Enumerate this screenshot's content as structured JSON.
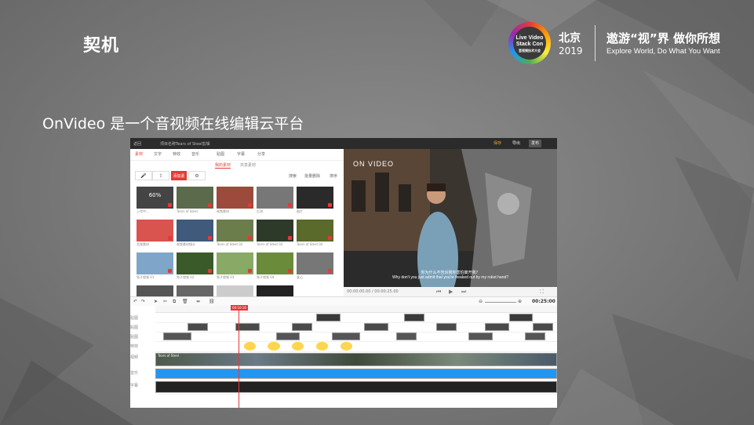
{
  "slide": {
    "title": "契机",
    "subtitle": "OnVideo 是一个音视频在线编辑云平台"
  },
  "brand": {
    "logo_lines": [
      "Live Video",
      "Stack Con",
      "音视频技术大会"
    ],
    "city": "北京",
    "year": "2019",
    "slogan": "遨游“视”界  做你所想",
    "slogan_en": "Explore World, Do What You Want"
  },
  "editor": {
    "topbar": {
      "back": "返回",
      "project_label": "项目名称",
      "project_name": "Tears of Steel剪辑",
      "save": "保存",
      "export": "导出",
      "publish": "发布"
    },
    "tabs": [
      "素材",
      "文字",
      "特效",
      "音乐",
      "贴图",
      "字幕",
      "分享"
    ],
    "active_tab": "素材",
    "subtabs": [
      "我的素材",
      "共享素材"
    ],
    "tools": {
      "mic": "🎤",
      "upload": "⇪",
      "add": "添加素材",
      "settings": "⚙",
      "search": "搜索",
      "batch": "批量删除",
      "sort": "排序"
    },
    "media": [
      {
        "caption": "上传中...",
        "label": "60%",
        "color": "#444"
      },
      {
        "caption": "Tears of Steel",
        "label": "",
        "color": "#5b6a4a"
      },
      {
        "caption": "视频素材",
        "label": "",
        "color": "#9c4a3b"
      },
      {
        "caption": "灯泡",
        "label": "",
        "color": "#777"
      },
      {
        "caption": "图片",
        "label": "",
        "color": "#2a2a2a"
      },
      {
        "caption": "音频素材",
        "label": "",
        "color": "#d9534f"
      },
      {
        "caption": "视频素材镜头",
        "label": "",
        "color": "#3f5a7a"
      },
      {
        "caption": "Tears of Steel 02",
        "label": "",
        "color": "#6b7d4a"
      },
      {
        "caption": "Tears of Steel 03",
        "label": "",
        "color": "#2d3a2a"
      },
      {
        "caption": "Tears of Steel 04",
        "label": "",
        "color": "#5a6a2a"
      },
      {
        "caption": "兔子视频 01",
        "label": "",
        "color": "#7fa6c9"
      },
      {
        "caption": "兔子视频 02",
        "label": "",
        "color": "#3a5a2a"
      },
      {
        "caption": "兔子视频 03",
        "label": "",
        "color": "#88aa66"
      },
      {
        "caption": "兔子视频 04",
        "label": "",
        "color": "#6a8c3a"
      },
      {
        "caption": "爱心",
        "label": "",
        "color": "#777"
      },
      {
        "caption": "",
        "label": "",
        "color": "#555"
      },
      {
        "caption": "",
        "label": "",
        "color": "#666"
      },
      {
        "caption": "",
        "label": "",
        "color": "#ccc"
      },
      {
        "caption": "",
        "label": "",
        "color": "#222"
      }
    ],
    "preview": {
      "brand": "ON VIDEO",
      "subtitle_cn": "你为什么不告诉我你害怕离开我？",
      "subtitle_en": "Why don't you just admit that you're freaked out by my robot hand?",
      "time": "00:00:00.00 / 00:00:25.00",
      "duration": "00:25:00"
    },
    "timeline": {
      "playhead_time": "00:10:16",
      "track_labels": [
        "贴图",
        "贴图",
        "贴图",
        "特效",
        "视频",
        "音乐",
        "字幕"
      ],
      "video_clip_label": "Tears of Steel"
    }
  }
}
